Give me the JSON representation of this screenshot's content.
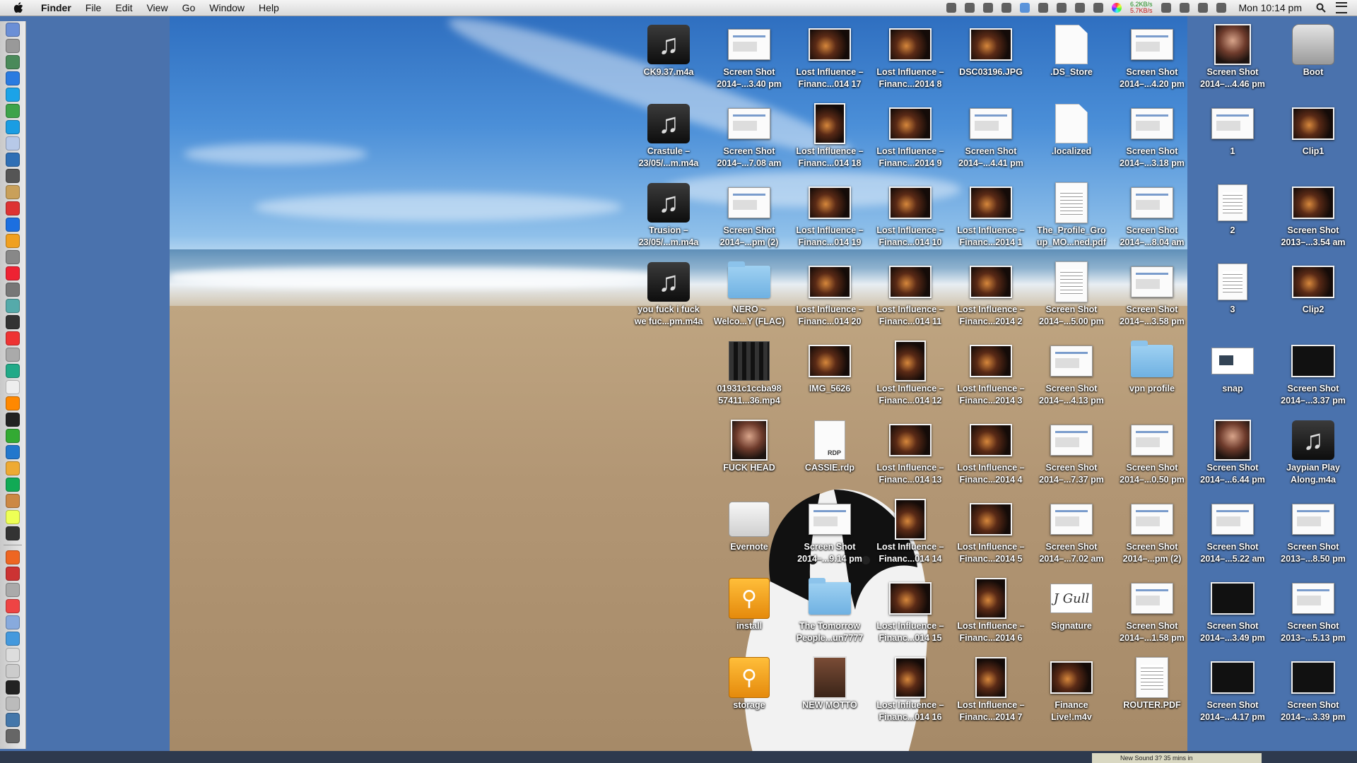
{
  "menubar": {
    "app_name": "Finder",
    "menus": [
      "File",
      "Edit",
      "View",
      "Go",
      "Window",
      "Help"
    ],
    "net_up": "6.2KB/s",
    "net_down": "5.7KB/s",
    "clock": "Mon 10:14 pm",
    "status_icons": [
      "evernote-icon",
      "arrow-icon",
      "camera-icon",
      "alien-icon",
      "dropbox-icon",
      "copy-icon",
      "target-icon",
      "display-icon",
      "battery-icon",
      "colorwheel-icon",
      "timemachine-icon",
      "bluetooth-icon",
      "wifi-icon",
      "volume-icon"
    ]
  },
  "notification": {
    "text": "New Sound 3? 35 mins in"
  },
  "desktop": {
    "columns": [
      [
        {
          "label": [
            "CK9.37.m4a"
          ],
          "icon": "music"
        },
        {
          "label": [
            "Crastule –",
            "23/05/...m.m4a"
          ],
          "icon": "music"
        },
        {
          "label": [
            "Trusion –",
            "23/05/...m.m4a"
          ],
          "icon": "music"
        },
        {
          "label": [
            "you fuck i fuck",
            "we fuc...pm.m4a"
          ],
          "icon": "music"
        }
      ],
      [
        {
          "label": [
            "Screen Shot",
            "2014–...3.40 pm"
          ],
          "icon": "shot"
        },
        {
          "label": [
            "Screen Shot",
            "2014–...7.08 am"
          ],
          "icon": "shot"
        },
        {
          "label": [
            "Screen Shot",
            "2014–...pm (2)"
          ],
          "icon": "shot"
        },
        {
          "label": [
            "NERO ~",
            "Welco...Y (FLAC)"
          ],
          "icon": "folder"
        },
        {
          "label": [
            "01931c1ccba98",
            "57411...36.mp4"
          ],
          "icon": "video"
        },
        {
          "label": [
            "FUCK HEAD"
          ],
          "icon": "portrait"
        },
        {
          "label": [
            "Evernote"
          ],
          "icon": "drive"
        },
        {
          "label": [
            "install"
          ],
          "icon": "usb"
        },
        {
          "label": [
            "storage"
          ],
          "icon": "usb"
        }
      ],
      [
        {
          "label": [
            "Lost Influence –",
            "Financ...014 17"
          ],
          "icon": "photo"
        },
        {
          "label": [
            "Lost Influence –",
            "Financ...014 18"
          ],
          "icon": "photo-tall"
        },
        {
          "label": [
            "Lost Influence –",
            "Financ...014 19"
          ],
          "icon": "photo"
        },
        {
          "label": [
            "Lost Influence –",
            "Financ...014 20"
          ],
          "icon": "photo"
        },
        {
          "label": [
            "IMG_5626"
          ],
          "icon": "photo"
        },
        {
          "label": [
            "CASSIE.rdp"
          ],
          "icon": "rdp"
        },
        {
          "label": [
            "Screen Shot",
            "2014–...9.14 pm"
          ],
          "icon": "shot"
        },
        {
          "label": [
            "The Tomorrow",
            "People...un7777"
          ],
          "icon": "folder"
        },
        {
          "label": [
            "NEW MOTTO"
          ],
          "icon": "motto"
        }
      ],
      [
        {
          "label": [
            "Lost Influence –",
            "Financ...2014 8"
          ],
          "icon": "photo"
        },
        {
          "label": [
            "Lost Influence –",
            "Financ...2014 9"
          ],
          "icon": "photo"
        },
        {
          "label": [
            "Lost Influence –",
            "Financ...014 10"
          ],
          "icon": "photo"
        },
        {
          "label": [
            "Lost Influence –",
            "Financ...014 11"
          ],
          "icon": "photo"
        },
        {
          "label": [
            "Lost Influence –",
            "Financ...014 12"
          ],
          "icon": "photo-tall"
        },
        {
          "label": [
            "Lost Influence –",
            "Financ...014 13"
          ],
          "icon": "photo"
        },
        {
          "label": [
            "Lost Influence –",
            "Financ...014 14"
          ],
          "icon": "photo-tall"
        },
        {
          "label": [
            "Lost Influence –",
            "Financ...014 15"
          ],
          "icon": "photo"
        },
        {
          "label": [
            "Lost Influence –",
            "Financ...014 16"
          ],
          "icon": "photo-tall"
        }
      ],
      [
        {
          "label": [
            "DSC03196.JPG"
          ],
          "icon": "photo"
        },
        {
          "label": [
            "Screen Shot",
            "2014–...4.41 pm"
          ],
          "icon": "shot"
        },
        {
          "label": [
            "Lost Influence –",
            "Financ...2014 1"
          ],
          "icon": "photo"
        },
        {
          "label": [
            "Lost Influence –",
            "Financ...2014 2"
          ],
          "icon": "photo"
        },
        {
          "label": [
            "Lost Influence –",
            "Financ...2014 3"
          ],
          "icon": "photo"
        },
        {
          "label": [
            "Lost Influence –",
            "Financ...2014 4"
          ],
          "icon": "photo"
        },
        {
          "label": [
            "Lost Influence –",
            "Financ...2014 5"
          ],
          "icon": "photo"
        },
        {
          "label": [
            "Lost Influence –",
            "Financ...2014 6"
          ],
          "icon": "photo-tall"
        },
        {
          "label": [
            "Lost Influence –",
            "Financ...2014 7"
          ],
          "icon": "photo-tall"
        }
      ],
      [
        {
          "label": [
            ".DS_Store"
          ],
          "icon": "blank"
        },
        {
          "label": [
            ".localized"
          ],
          "icon": "blank"
        },
        {
          "label": [
            "The_Profile_Gro",
            "up_MO...ned.pdf"
          ],
          "icon": "doc"
        },
        {
          "label": [
            "Screen Shot",
            "2014–...5.00 pm"
          ],
          "icon": "doc"
        },
        {
          "label": [
            "Screen Shot",
            "2014–...4.13 pm"
          ],
          "icon": "shot"
        },
        {
          "label": [
            "Screen Shot",
            "2014–...7.37 pm"
          ],
          "icon": "shot"
        },
        {
          "label": [
            "Screen Shot",
            "2014–...7.02 am"
          ],
          "icon": "shot"
        },
        {
          "label": [
            "Signature"
          ],
          "icon": "sig"
        },
        {
          "label": [
            "Finance",
            "Live!.m4v"
          ],
          "icon": "photo"
        }
      ],
      [
        {
          "label": [
            "Screen Shot",
            "2014–...4.20 pm"
          ],
          "icon": "shot"
        },
        {
          "label": [
            "Screen Shot",
            "2014–...3.18 pm"
          ],
          "icon": "shot"
        },
        {
          "label": [
            "Screen Shot",
            "2014–...8.04 am"
          ],
          "icon": "shot"
        },
        {
          "label": [
            "Screen Shot",
            "2014–...3.58 pm"
          ],
          "icon": "shot"
        },
        {
          "label": [
            "vpn profile"
          ],
          "icon": "folder"
        },
        {
          "label": [
            "Screen Shot",
            "2014–...0.50 pm"
          ],
          "icon": "shot"
        },
        {
          "label": [
            "Screen Shot",
            "2014–...pm (2)"
          ],
          "icon": "shot"
        },
        {
          "label": [
            "Screen Shot",
            "2014–...1.58 pm"
          ],
          "icon": "shot"
        },
        {
          "label": [
            "ROUTER.PDF"
          ],
          "icon": "doc"
        }
      ],
      [
        {
          "label": [
            "Screen Shot",
            "2014–...4.46 pm"
          ],
          "icon": "portrait"
        },
        {
          "label": [
            "1"
          ],
          "icon": "shot"
        },
        {
          "label": [
            "2"
          ],
          "icon": "doc-small"
        },
        {
          "label": [
            "3"
          ],
          "icon": "doc-small"
        },
        {
          "label": [
            "snap"
          ],
          "icon": "snap"
        },
        {
          "label": [
            "Screen Shot",
            "2014–...6.44 pm"
          ],
          "icon": "portrait"
        },
        {
          "label": [
            "Screen Shot",
            "2014–...5.22 am"
          ],
          "icon": "shot"
        },
        {
          "label": [
            "Screen Shot",
            "2014–...3.49 pm"
          ],
          "icon": "shotdark"
        },
        {
          "label": [
            "Screen Shot",
            "2014–...4.17 pm"
          ],
          "icon": "shotdark"
        }
      ],
      [
        {
          "label": [
            "Boot"
          ],
          "icon": "hdd"
        },
        {
          "label": [
            "Clip1"
          ],
          "icon": "photo"
        },
        {
          "label": [
            "Screen Shot",
            "2013–...3.54 am"
          ],
          "icon": "photo"
        },
        {
          "label": [
            "Clip2"
          ],
          "icon": "photo"
        },
        {
          "label": [
            "Screen Shot",
            "2014–...3.37 pm"
          ],
          "icon": "shotdark"
        },
        {
          "label": [
            "Jaypian Play",
            "Along.m4a"
          ],
          "icon": "music"
        },
        {
          "label": [
            "Screen Shot",
            "2013–...8.50 pm"
          ],
          "icon": "shot"
        },
        {
          "label": [
            "Screen Shot",
            "2013–...5.13 pm"
          ],
          "icon": "shot"
        },
        {
          "label": [
            "Screen Shot",
            "2014–...3.39 pm"
          ],
          "icon": "shotdark"
        }
      ]
    ]
  }
}
